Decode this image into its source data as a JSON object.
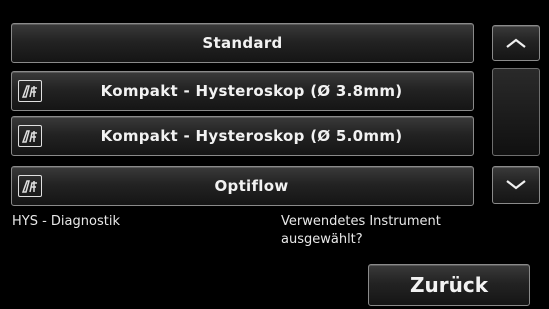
{
  "options": [
    {
      "label": "Standard",
      "icon": null
    },
    {
      "label": "Kompakt - Hysteroskop (Ø 3.8mm)",
      "icon": "procedure-icon"
    },
    {
      "label": "Kompakt - Hysteroskop (Ø 5.0mm)",
      "icon": "procedure-icon"
    },
    {
      "label": "Optiflow",
      "icon": "procedure-icon"
    }
  ],
  "scroll": {
    "up_icon": "chevron-up-icon",
    "down_icon": "chevron-down-icon"
  },
  "mode_label": "HYS - Diagnostik",
  "prompt": {
    "line1": "Verwendetes Instrument",
    "line2": "ausgewählt?"
  },
  "back_label": "Zurück",
  "colors": {
    "background": "#000000",
    "button_border": "#8a8a8a",
    "text": "#ffffff"
  }
}
